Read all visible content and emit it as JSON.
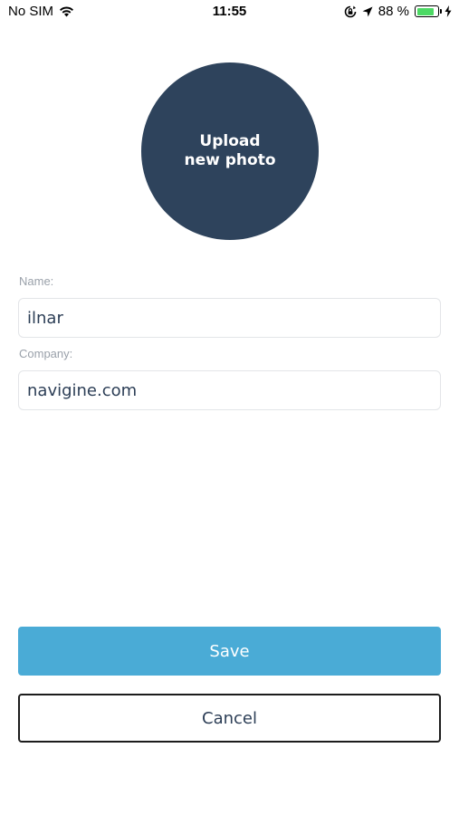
{
  "status_bar": {
    "carrier": "No SIM",
    "time": "11:55",
    "battery_percent": "88 %",
    "battery_level": 0.88,
    "battery_color": "#4cd964",
    "icons": [
      "wifi-icon",
      "rotation-lock-icon",
      "location-arrow-icon",
      "battery-icon",
      "charging-bolt-icon"
    ]
  },
  "avatar": {
    "label": "Upload\nnew photo",
    "color": "#2e435c"
  },
  "form": {
    "name": {
      "label": "Name:",
      "value": "ilnar"
    },
    "company": {
      "label": "Company:",
      "value": "navigine.com"
    }
  },
  "buttons": {
    "save_label": "Save",
    "cancel_label": "Cancel",
    "save_color": "#4aabd6"
  }
}
